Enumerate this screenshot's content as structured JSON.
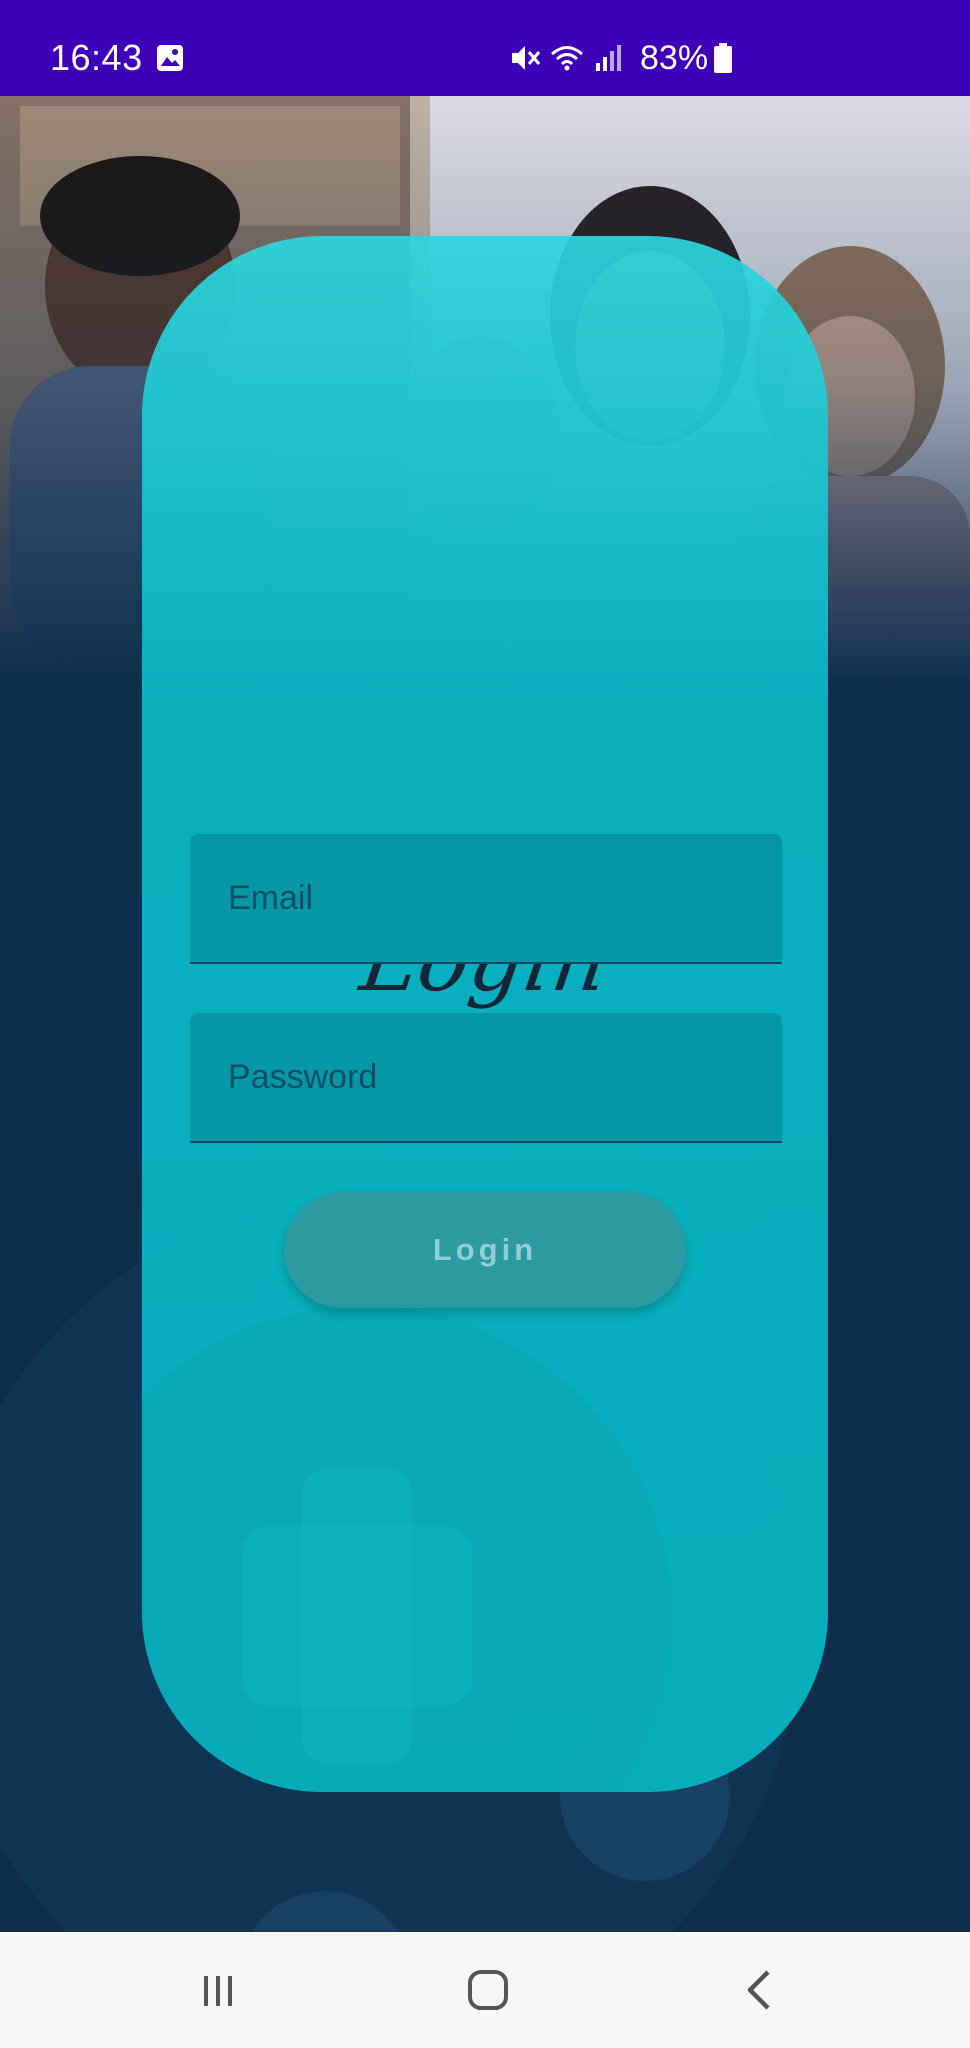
{
  "status_bar": {
    "time": "16:43",
    "battery": "83%",
    "icons": [
      "gallery-notification-icon",
      "mute-icon",
      "wifi-icon",
      "signal-icon",
      "battery-icon"
    ]
  },
  "login": {
    "title": "Login",
    "email_placeholder": "Email",
    "password_placeholder": "Password",
    "button_label": "Login"
  },
  "nav_bar": {
    "buttons": [
      "recents-icon",
      "home-icon",
      "back-icon"
    ]
  },
  "colors": {
    "status_bar": "#3d00b8",
    "card": "#06b0be",
    "field": "#0597a6",
    "button": "#2c9aa0",
    "background": "#0f2e4e"
  }
}
